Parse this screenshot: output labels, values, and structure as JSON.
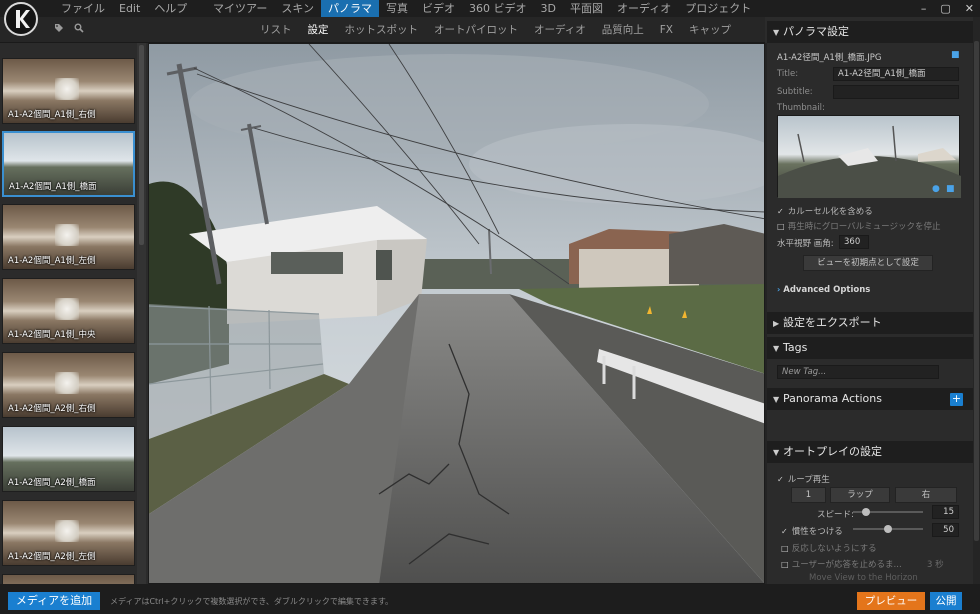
{
  "menu": {
    "left": [
      "ファイル",
      "Edit",
      "ヘルプ"
    ],
    "main": [
      "マイツアー",
      "スキン",
      "パノラマ",
      "写真",
      "ビデオ",
      "360 ビデオ",
      "3D",
      "平面図",
      "オーディオ",
      "プロジェクト"
    ],
    "active_index": 2,
    "window_controls": [
      "–",
      "▢",
      "✕"
    ]
  },
  "subtabs": {
    "items": [
      "リスト",
      "設定",
      "ホットスポット",
      "オートパイロット",
      "オーディオ",
      "品質向上",
      "FX",
      "キャップ"
    ],
    "active_index": 1,
    "icons": [
      "tag-icon",
      "search-icon"
    ]
  },
  "thumbnails": [
    {
      "caption": "A1-A2個間_A1側_右側",
      "style": "rock",
      "selected": false
    },
    {
      "caption": "A1-A2個間_A1側_橋面",
      "style": "sky",
      "selected": true
    },
    {
      "caption": "A1-A2個間_A1側_左側",
      "style": "rock",
      "selected": false
    },
    {
      "caption": "A1-A2個間_A1側_中央",
      "style": "rock",
      "selected": false
    },
    {
      "caption": "A1-A2個間_A2側_右側",
      "style": "rock",
      "selected": false
    },
    {
      "caption": "A1-A2個間_A2側_橋面",
      "style": "sky",
      "selected": false
    },
    {
      "caption": "A1-A2個間_A2側_左側",
      "style": "rock",
      "selected": false
    },
    {
      "caption": "",
      "style": "rock",
      "selected": false
    }
  ],
  "panel": {
    "panorama_settings": {
      "header": "パノラマ設定",
      "filename": "A1-A2径間_A1側_橋面.JPG",
      "title_label": "Title:",
      "title_value": "A1-A2径間_A1側_橋面",
      "subtitle_label": "Subtitle:",
      "subtitle_value": "",
      "thumbnail_label": "Thumbnail:",
      "carousel_label": "カルーセル化を含める",
      "carousel_checked": true,
      "stop_music_label": "再生時にグローバルミュージックを停止",
      "stop_music_checked": false,
      "fov_label": "水平視野 画角:",
      "fov_value": "360",
      "set_initial_view_button": "ビューを初期点として設定",
      "advanced_options": "Advanced Options"
    },
    "export_settings": {
      "header": "設定をエクスポート"
    },
    "tags": {
      "header": "Tags",
      "new_tag_placeholder": "New Tag..."
    },
    "panorama_actions": {
      "header": "Panorama Actions",
      "add_icon": "+"
    },
    "autoplay": {
      "header": "オートプレイの設定",
      "loop_label": "ループ再生",
      "loop_checked": true,
      "loop_count": "1",
      "loop_mode": "ラップ",
      "direction": "右",
      "speed_label": "スピード:",
      "speed_value": "15",
      "speed_level": 0.15,
      "inertia_label": "慣性をつける",
      "inertia_checked": true,
      "inertia_value": "50",
      "inertia_level": 0.5,
      "no_react_label": "反応しないようにする",
      "no_react_checked": false,
      "stop_on_user_label": "ユーザーが応答を止めるま...",
      "stop_on_user_checked": false,
      "stop_seconds": "3 秒",
      "move_to_horizon_label": "Move View to the Horizon"
    }
  },
  "bottom": {
    "add_media": "メディアを追加",
    "hint": "メディアはCtrl+クリックで複数選択ができ、ダブルクリックで編集できます。",
    "preview": "プレビュー",
    "publish": "公開"
  }
}
